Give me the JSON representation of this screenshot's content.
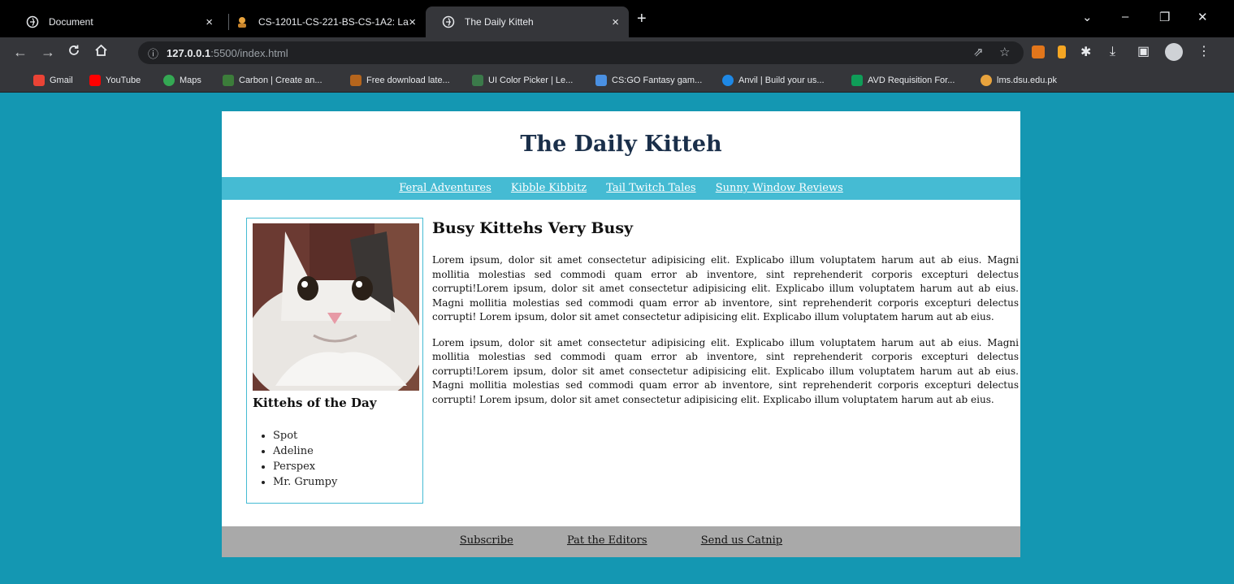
{
  "browser": {
    "tabs": [
      {
        "title": "Document",
        "close": "×"
      },
      {
        "title": "CS-1201L-CS-221-BS-CS-1A2: La",
        "close": "×"
      },
      {
        "title": "The Daily Kitteh",
        "close": "×"
      }
    ],
    "new_tab": "+",
    "window_controls": {
      "minimize": "–",
      "restore": "❐",
      "close": "✕",
      "dropdown": "⌄"
    },
    "address": {
      "host": "127.0.0.1",
      "rest": ":5500/index.html"
    },
    "bookmarks": [
      {
        "label": "Gmail",
        "color": "#ea4335"
      },
      {
        "label": "YouTube",
        "color": "#ff0000"
      },
      {
        "label": "Maps",
        "color": "#34a853"
      },
      {
        "label": "Carbon | Create an...",
        "color": "#3c7d3a"
      },
      {
        "label": "Free download late...",
        "color": "#b5651d"
      },
      {
        "label": "UI Color Picker | Le...",
        "color": "#3b7a4a"
      },
      {
        "label": "CS:GO Fantasy gam...",
        "color": "#4a90e2"
      },
      {
        "label": "Anvil | Build your us...",
        "color": "#1e88e5"
      },
      {
        "label": "AVD Requisition For...",
        "color": "#0f9d58"
      },
      {
        "label": "lms.dsu.edu.pk",
        "color": "#e8a33d"
      }
    ]
  },
  "page": {
    "title": "The Daily Kitteh",
    "nav": [
      "Feral Adventures",
      "Kibble Kibbitz",
      "Tail Twitch Tales",
      "Sunny Window Reviews"
    ],
    "sidebar": {
      "heading": "Kittehs of the Day",
      "kittens": [
        "Spot",
        "Adeline",
        "Perspex",
        "Mr. Grumpy"
      ]
    },
    "article": {
      "heading": "Busy Kittehs Very Busy",
      "paragraphs": [
        "Lorem ipsum, dolor sit amet consectetur adipisicing elit. Explicabo illum voluptatem harum aut ab eius. Magni mollitia molestias sed commodi quam error ab inventore, sint reprehenderit corporis excepturi delectus corrupti!Lorem ipsum, dolor sit amet consectetur adipisicing elit. Explicabo illum voluptatem harum aut ab eius. Magni mollitia molestias sed commodi quam error ab inventore, sint reprehenderit corporis excepturi delectus corrupti! Lorem ipsum, dolor sit amet consectetur adipisicing elit. Explicabo illum voluptatem harum aut ab eius.",
        "Lorem ipsum, dolor sit amet consectetur adipisicing elit. Explicabo illum voluptatem harum aut ab eius. Magni mollitia molestias sed commodi quam error ab inventore, sint reprehenderit corporis excepturi delectus corrupti!Lorem ipsum, dolor sit amet consectetur adipisicing elit. Explicabo illum voluptatem harum aut ab eius. Magni mollitia molestias sed commodi quam error ab inventore, sint reprehenderit corporis excepturi delectus corrupti! Lorem ipsum, dolor sit amet consectetur adipisicing elit. Explicabo illum voluptatem harum aut ab eius."
      ]
    },
    "footer": [
      "Subscribe",
      "Pat the Editors",
      "Send us Catnip"
    ]
  },
  "colors": {
    "page_bg": "#1497b2",
    "nav_bar": "#45bbd3",
    "title_text": "#1a2f4a",
    "footer_bar": "#a9a9a9",
    "chrome_dark": "#35363a"
  }
}
